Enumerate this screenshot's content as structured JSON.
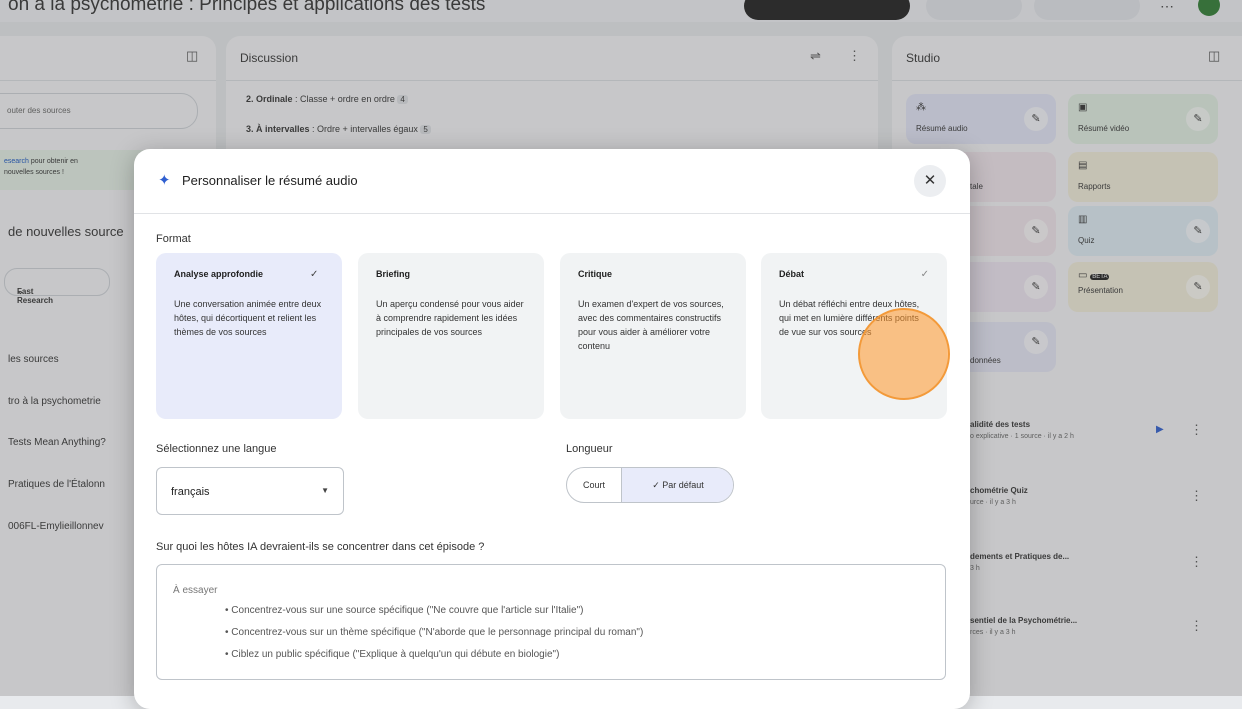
{
  "window": {
    "title": "on à la psychométrie : Principes et applications des tests"
  },
  "left_panel": {
    "search_placeholder": "outer des sources",
    "banner_link": "esearch",
    "banner_text": "pour obtenir en",
    "banner_text2": "nouvelles sources !",
    "new_sources_label": "de nouvelles source",
    "research_chip": "Fast Research",
    "select_all": "les sources",
    "items": [
      "tro à la psychometrie",
      "Tests Mean Anything?",
      "Pratiques de l'Étalonn",
      "006FL-Emylieillonnev"
    ]
  },
  "discussion": {
    "header": "Discussion",
    "line1_prefix": "2. Ordinale",
    "line1_text": " : Classe + ordre en ordre",
    "line1_badge": "4",
    "line2_prefix": "3. À intervalles",
    "line2_text": " : Ordre + intervalles égaux",
    "line2_badge": "5"
  },
  "studio": {
    "header": "Studio",
    "tiles": [
      {
        "label": "Résumé audio"
      },
      {
        "label": "Résumé vidéo"
      },
      {
        "label": "tale"
      },
      {
        "label": "Rapports"
      },
      {
        "label": "Quiz"
      },
      {
        "label": "Présentation",
        "badge": "BETA"
      },
      {
        "label": "données"
      }
    ],
    "notes": [
      {
        "title": "alidité des tests",
        "meta": "o explicative · 1 source · il y a 2 h"
      },
      {
        "title": "chométrie Quiz",
        "meta": "urce · il y a 3 h"
      },
      {
        "title": "dements et Pratiques de...",
        "meta": "3 h"
      },
      {
        "title": "sentiel de la Psychométrie...",
        "meta": "rces · il y a 3 h"
      }
    ]
  },
  "modal": {
    "title": "Personnaliser le résumé audio",
    "format_label": "Format",
    "formats": [
      {
        "title": "Analyse approfondie",
        "desc": "Une conversation animée entre deux hôtes, qui décortiquent et relient les thèmes de vos sources",
        "selected": true
      },
      {
        "title": "Briefing",
        "desc": "Un aperçu condensé pour vous aider à comprendre rapidement les idées principales de vos sources",
        "selected": false
      },
      {
        "title": "Critique",
        "desc": "Un examen d'expert de vos sources, avec des commentaires constructifs pour vous aider à améliorer votre contenu",
        "selected": false
      },
      {
        "title": "Débat",
        "desc": "Un débat réfléchi entre deux hôtes, qui met en lumière différents points de vue sur vos sources",
        "selected": false
      }
    ],
    "language_label": "Sélectionnez une langue",
    "language_value": "français",
    "length_label": "Longueur",
    "length_options": [
      "Court",
      "Par défaut"
    ],
    "length_selected": "Par défaut",
    "focus_label": "Sur quoi les hôtes IA devraient-ils se concentrer dans cet épisode ?",
    "focus_placeholder": "À essayer",
    "focus_suggestions": [
      "• Concentrez-vous sur une source spécifique (\"Ne couvre que l'article sur l'Italie\")",
      "• Concentrez-vous sur un thème spécifique (\"N'aborde que le personnage principal du roman\")",
      "• Ciblez un public spécifique (\"Explique à quelqu'un qui débute en biologie\")"
    ]
  },
  "colors": {
    "accent": "#2f5fd0",
    "selected_card": "#e8ebfa",
    "pointer": "#f39a3a"
  }
}
